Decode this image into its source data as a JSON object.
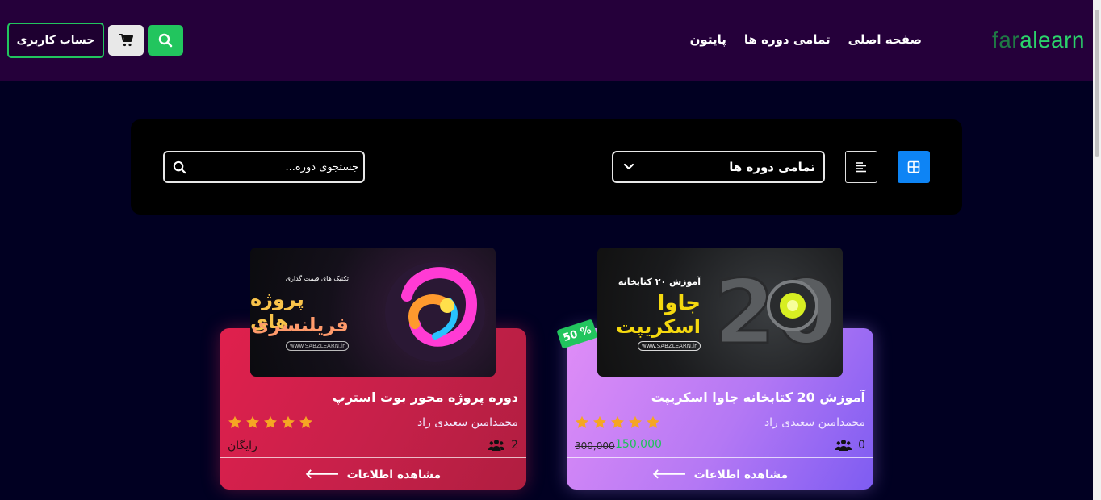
{
  "header": {
    "logo_part1": "far",
    "logo_part2": "alearn",
    "nav": [
      "صفحه اصلی",
      "تمامی دوره ها",
      "پایتون"
    ],
    "account_label": "حساب کاربری"
  },
  "filters": {
    "selected_category": "تمامی دوره ها",
    "search_placeholder": "جستجوی دوره..."
  },
  "courses": [
    {
      "title": "آموزش 20 کتابخانه جاوا اسکریپت",
      "teacher": "محمدامین سعیدی راد",
      "rating": 5,
      "students": "0",
      "price_old": "300,000",
      "price_new": "150,000",
      "discount": "50 %",
      "more_label": "مشاهده اطلاعات",
      "thumb_line1": "آموزش ۲۰ کتابخانه",
      "thumb_line2": "جاوا",
      "thumb_line3": "اسکریپت",
      "thumb_site": "www.SABZLEARN.ir"
    },
    {
      "title": "دوره پروژه محور بوت استرپ",
      "teacher": "محمدامین سعیدی راد",
      "rating": 5,
      "students": "2",
      "price": "رایگان",
      "more_label": "مشاهده اطلاعات",
      "thumb_line1": "تکنیک های قیمت گذاری",
      "thumb_line2": "پروژه های",
      "thumb_line3": "فریلنسری",
      "thumb_site": "www.SABZLEARN.ir"
    }
  ]
}
